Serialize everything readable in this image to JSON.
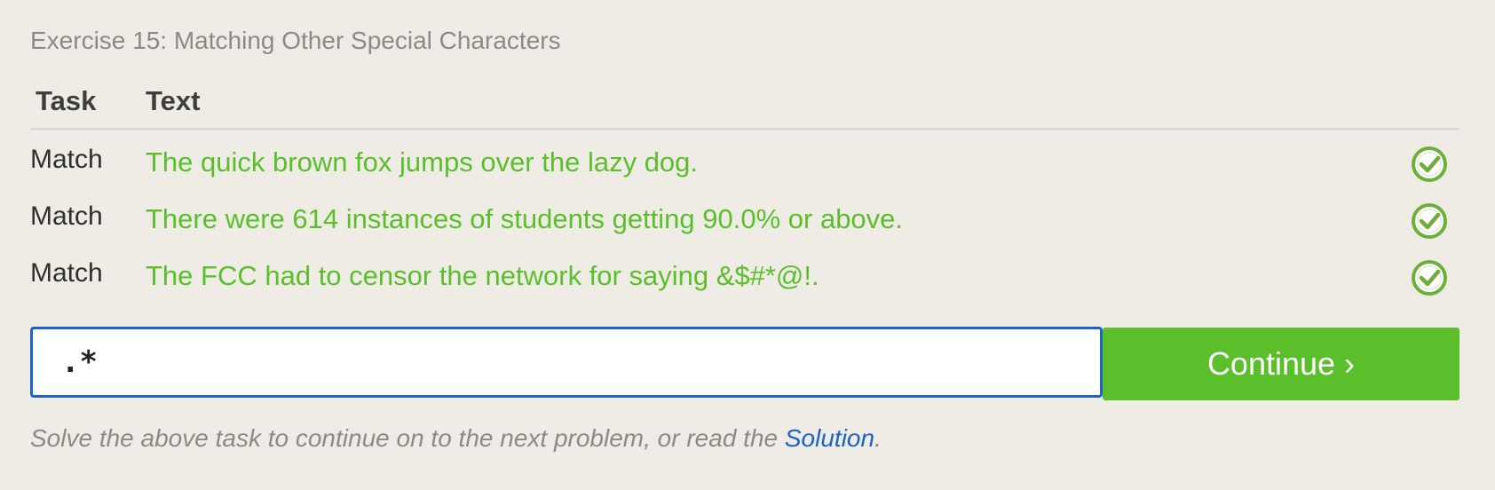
{
  "exercise": {
    "title": "Exercise 15: Matching Other Special Characters"
  },
  "table": {
    "headers": {
      "task": "Task",
      "text": "Text"
    },
    "rows": [
      {
        "task": "Match",
        "text": "The quick brown fox jumps over the lazy dog.",
        "status_icon": "check-circle-icon"
      },
      {
        "task": "Match",
        "text": "There were 614 instances of students getting 90.0% or above.",
        "status_icon": "check-circle-icon"
      },
      {
        "task": "Match",
        "text": "The FCC had to censor the network for saying &$#*@!.",
        "status_icon": "check-circle-icon"
      }
    ]
  },
  "input": {
    "value": ".*"
  },
  "continue_button": {
    "label": "Continue ›"
  },
  "hint": {
    "prefix": "Solve the above task to continue on to the next problem, or read the ",
    "link": "Solution",
    "suffix": "."
  },
  "colors": {
    "background": "#efece5",
    "match_green": "#5bbf2c",
    "accent_blue": "#1c63c7",
    "muted_text": "#8a8a88"
  }
}
